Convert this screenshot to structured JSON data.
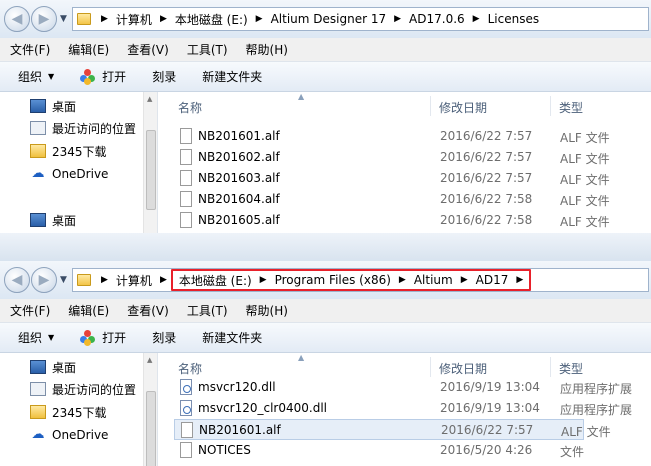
{
  "menus": [
    "文件(F)",
    "编辑(E)",
    "查看(V)",
    "工具(T)",
    "帮助(H)"
  ],
  "toolbar": {
    "organize": "组织",
    "open": "打开",
    "burn": "刻录",
    "new_folder": "新建文件夹"
  },
  "columns": {
    "name": "名称",
    "date": "修改日期",
    "type": "类型"
  },
  "pane1": {
    "breadcrumb": [
      "计算机",
      "本地磁盘 (E:)",
      "Altium Designer 17",
      "AD17.0.6",
      "Licenses"
    ],
    "nav": [
      "桌面",
      "最近访问的位置",
      "2345下载",
      "OneDrive",
      "桌面"
    ],
    "files": [
      {
        "name": "NB201601.alf",
        "date": "2016/6/22 7:57",
        "type": "ALF 文件",
        "icon": "file-icon"
      },
      {
        "name": "NB201602.alf",
        "date": "2016/6/22 7:57",
        "type": "ALF 文件",
        "icon": "file-icon"
      },
      {
        "name": "NB201603.alf",
        "date": "2016/6/22 7:57",
        "type": "ALF 文件",
        "icon": "file-icon"
      },
      {
        "name": "NB201604.alf",
        "date": "2016/6/22 7:58",
        "type": "ALF 文件",
        "icon": "file-icon"
      },
      {
        "name": "NB201605.alf",
        "date": "2016/6/22 7:58",
        "type": "ALF 文件",
        "icon": "file-icon"
      }
    ]
  },
  "pane2": {
    "breadcrumb_pc": "计算机",
    "breadcrumb": [
      "本地磁盘 (E:)",
      "Program Files (x86)",
      "Altium",
      "AD17"
    ],
    "nav": [
      "桌面",
      "最近访问的位置",
      "2345下载",
      "OneDrive"
    ],
    "files": [
      {
        "name": "msvcr120.dll",
        "date": "2016/9/19 13:04",
        "type": "应用程序扩展",
        "icon": "dll-icon"
      },
      {
        "name": "msvcr120_clr0400.dll",
        "date": "2016/9/19 13:04",
        "type": "应用程序扩展",
        "icon": "dll-icon"
      },
      {
        "name": "NB201601.alf",
        "date": "2016/6/22 7:57",
        "type": "ALF 文件",
        "icon": "file-icon"
      },
      {
        "name": "NOTICES",
        "date": "2016/5/20 4:26",
        "type": "文件",
        "icon": "file-icon"
      }
    ]
  },
  "colors": {
    "highlight_box": "#e8202a",
    "selection": "#e6eef8",
    "header_text": "#4c607a"
  }
}
